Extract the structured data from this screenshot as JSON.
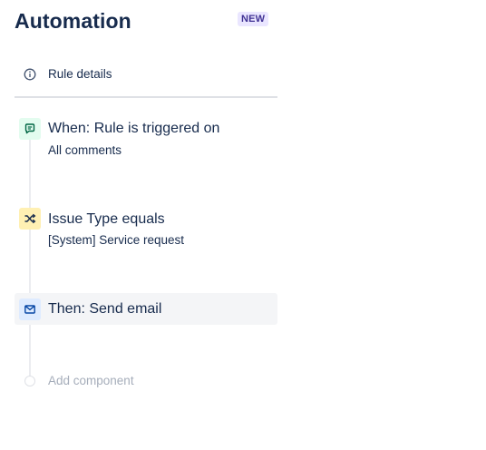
{
  "header": {
    "title": "Automation",
    "badge": "NEW"
  },
  "rule_details": {
    "label": "Rule details",
    "icon": "info-icon"
  },
  "steps": [
    {
      "kind": "trigger",
      "title": "When: Rule is triggered on",
      "subtitle": "All comments",
      "icon": "comment-icon",
      "icon_bg": "#e3fcef",
      "icon_color": "#006644"
    },
    {
      "kind": "condition",
      "title": "Issue Type equals",
      "subtitle": "[System] Service request",
      "icon": "shuffle-icon",
      "icon_bg": "#fff0b3",
      "icon_color": "#172b4d"
    },
    {
      "kind": "action",
      "title": "Then: Send email",
      "icon": "email-icon",
      "icon_bg": "#deebff",
      "icon_color": "#0747a6",
      "selected": true
    }
  ],
  "add_component": {
    "label": "Add component"
  },
  "colors": {
    "text": "#172b4d",
    "muted": "#a5adba",
    "badge_bg": "#eae6ff",
    "badge_text": "#403294",
    "divider": "#dfe1e6",
    "selected_bg": "#f4f5f7"
  }
}
